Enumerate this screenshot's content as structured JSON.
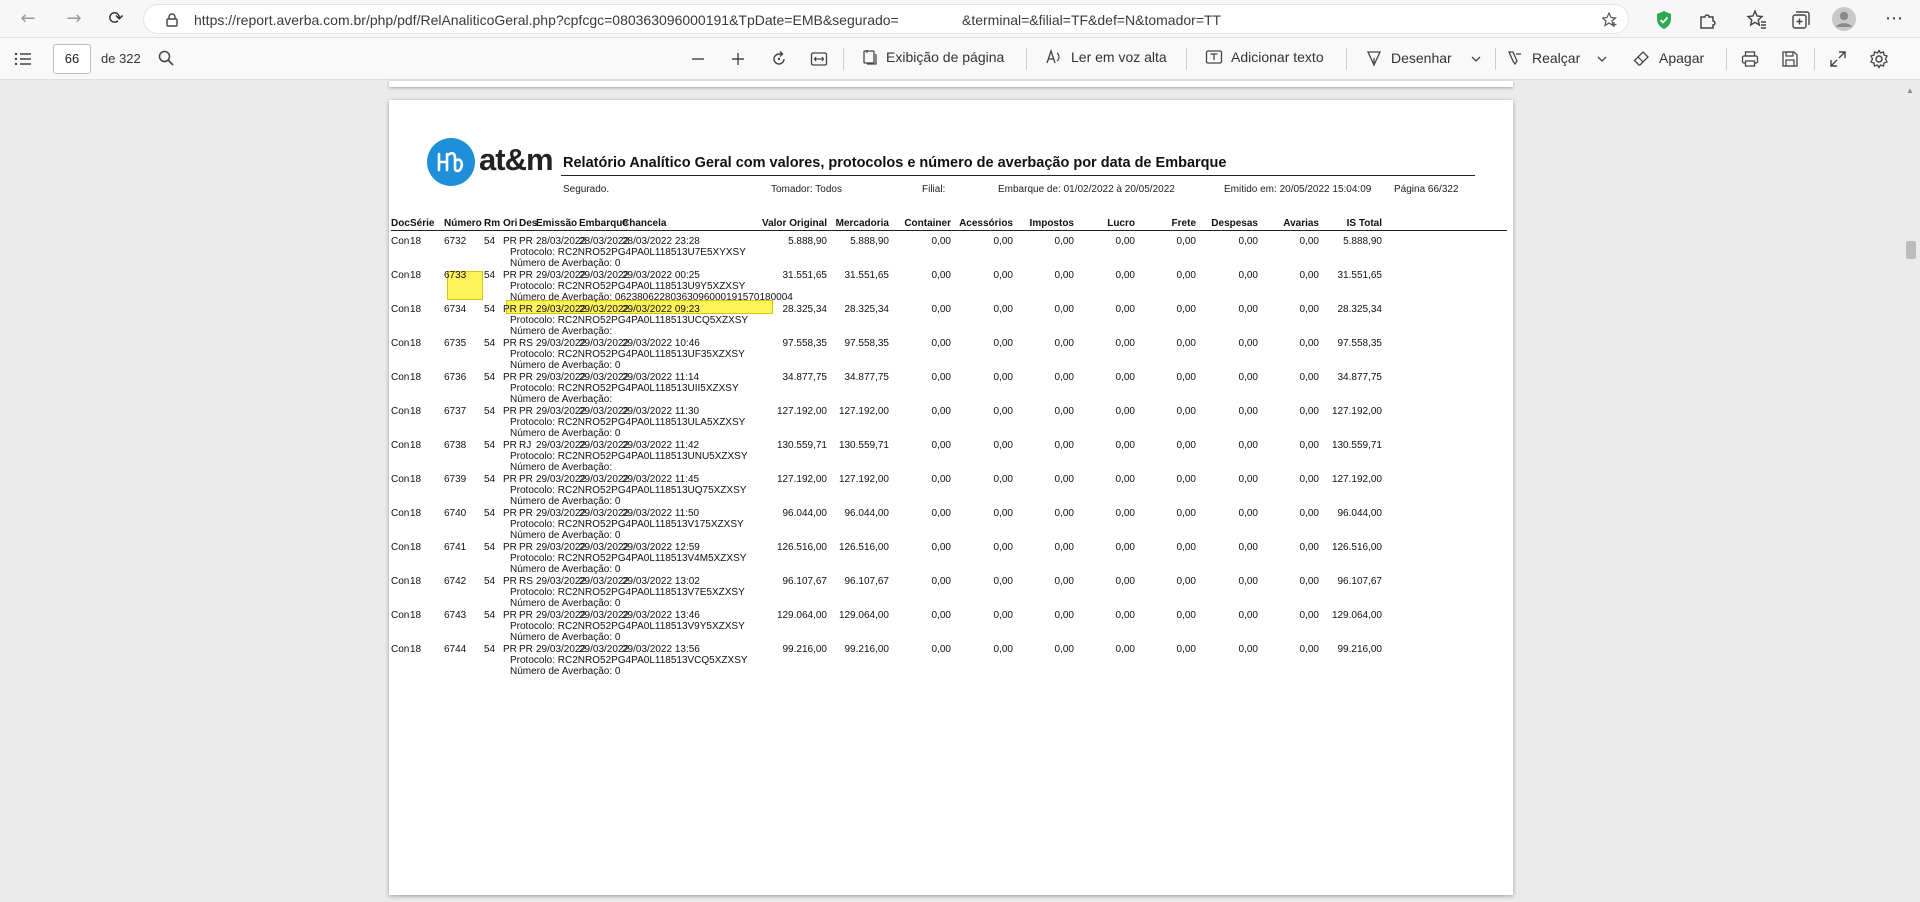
{
  "browser": {
    "url": "https://report.averba.com.br/php/pdf/RelAnaliticoGeral.php?cpfcgc=08036309600019​1&TpDate=EMB&segurado=",
    "url_part1": "https://report.averba.com.br/php/pdf/RelAnaliticoGeral.php?cpfcgc=080363096000191&TpDate=EMB&segurado=",
    "url_part2": "&terminal=&filial=TF&def=N&tomador=TT"
  },
  "pdf_toolbar": {
    "page_current": "66",
    "page_total": "de 322",
    "page_view_label": "Exibição de página",
    "read_aloud_label": "Ler em voz alta",
    "add_text_label": "Adicionar texto",
    "draw_label": "Desenhar",
    "highlight_label": "Realçar",
    "erase_label": "Apagar"
  },
  "report": {
    "logo_text": "at&m",
    "title": "Relatório Analítico Geral com valores, protocolos e número de averbação por data de Embarque",
    "segurado_label": "Segurado.",
    "tomador_label": "Tomador: Todos",
    "filial_label": "Filial:",
    "embarque_label": "Embarque de: 01/02/2022 à 20/05/2022",
    "emitido_label": "Emitido em: 20/05/2022 15:04:09",
    "pagina_label": "Página 66/322",
    "columns": [
      "Doc",
      "Série",
      "Número",
      "Rm",
      "Ori",
      "Des",
      "Emissão",
      "Embarque",
      "Chancela",
      "Valor Original",
      "Mercadoria",
      "Container",
      "Acessórios",
      "Impostos",
      "Lucro",
      "Frete",
      "Despesas",
      "Avarias",
      "IS Total"
    ],
    "protocol_label": "Protocolo:",
    "averbacao_label": "Número de Averbação:",
    "highlighted_averbacao": "Número de Averbação: 06238062280363096000191570180004",
    "rows": [
      {
        "doc": "Con",
        "serie": "18",
        "numero": "6732",
        "rm": "54",
        "ori": "PR",
        "des": "PR",
        "emissao": "28/03/2022",
        "embarque": "28/03/2022",
        "chancela": "28/03/2022 23:28",
        "valor": "5.888,90",
        "mercadoria": "5.888,90",
        "container": "0,00",
        "acessorios": "0,00",
        "impostos": "0,00",
        "lucro": "0,00",
        "frete": "0,00",
        "despesas": "0,00",
        "avarias": "0,00",
        "is_total": "5.888,90",
        "protocolo": "Protocolo: RC2NRO52PG4PA0L118513U7E5XYXSY",
        "averbacao": "Número de Averbação: 0"
      },
      {
        "doc": "Con",
        "serie": "18",
        "numero": "6733",
        "rm": "54",
        "ori": "PR",
        "des": "PR",
        "emissao": "29/03/2022",
        "embarque": "29/03/2022",
        "chancela": "29/03/2022 00:25",
        "valor": "31.551,65",
        "mercadoria": "31.551,65",
        "container": "0,00",
        "acessorios": "0,00",
        "impostos": "0,00",
        "lucro": "0,00",
        "frete": "0,00",
        "despesas": "0,00",
        "avarias": "0,00",
        "is_total": "31.551,65",
        "protocolo": "Protocolo: RC2NRO52PG4PA0L118513U9Y5XZXSY",
        "averbacao": "Número de Averbação: 06238062280363096000191570180004"
      },
      {
        "doc": "Con",
        "serie": "18",
        "numero": "6734",
        "rm": "54",
        "ori": "PR",
        "des": "PR",
        "emissao": "29/03/2022",
        "embarque": "29/03/2022",
        "chancela": "29/03/2022 09:23",
        "valor": "28.325,34",
        "mercadoria": "28.325,34",
        "container": "0,00",
        "acessorios": "0,00",
        "impostos": "0,00",
        "lucro": "0,00",
        "frete": "0,00",
        "despesas": "0,00",
        "avarias": "0,00",
        "is_total": "28.325,34",
        "protocolo": "Protocolo: RC2NRO52PG4PA0L118513UCQ5XZXSY",
        "averbacao": "Número de Averbação:"
      },
      {
        "doc": "Con",
        "serie": "18",
        "numero": "6735",
        "rm": "54",
        "ori": "PR",
        "des": "RS",
        "emissao": "29/03/2022",
        "embarque": "29/03/2022",
        "chancela": "29/03/2022 10:46",
        "valor": "97.558,35",
        "mercadoria": "97.558,35",
        "container": "0,00",
        "acessorios": "0,00",
        "impostos": "0,00",
        "lucro": "0,00",
        "frete": "0,00",
        "despesas": "0,00",
        "avarias": "0,00",
        "is_total": "97.558,35",
        "protocolo": "Protocolo: RC2NRO52PG4PA0L118513UF35XZXSY",
        "averbacao": "Número de Averbação: 0"
      },
      {
        "doc": "Con",
        "serie": "18",
        "numero": "6736",
        "rm": "54",
        "ori": "PR",
        "des": "PR",
        "emissao": "29/03/2022",
        "embarque": "29/03/2022",
        "chancela": "29/03/2022 11:14",
        "valor": "34.877,75",
        "mercadoria": "34.877,75",
        "container": "0,00",
        "acessorios": "0,00",
        "impostos": "0,00",
        "lucro": "0,00",
        "frete": "0,00",
        "despesas": "0,00",
        "avarias": "0,00",
        "is_total": "34.877,75",
        "protocolo": "Protocolo: RC2NRO52PG4PA0L118513UII5XZXSY",
        "averbacao": "Número de Averbação:"
      },
      {
        "doc": "Con",
        "serie": "18",
        "numero": "6737",
        "rm": "54",
        "ori": "PR",
        "des": "PR",
        "emissao": "29/03/2022",
        "embarque": "29/03/2022",
        "chancela": "29/03/2022 11:30",
        "valor": "127.192,00",
        "mercadoria": "127.192,00",
        "container": "0,00",
        "acessorios": "0,00",
        "impostos": "0,00",
        "lucro": "0,00",
        "frete": "0,00",
        "despesas": "0,00",
        "avarias": "0,00",
        "is_total": "127.192,00",
        "protocolo": "Protocolo: RC2NRO52PG4PA0L118513ULA5XZXSY",
        "averbacao": "Número de Averbação: 0"
      },
      {
        "doc": "Con",
        "serie": "18",
        "numero": "6738",
        "rm": "54",
        "ori": "PR",
        "des": "RJ",
        "emissao": "29/03/2022",
        "embarque": "29/03/2022",
        "chancela": "29/03/2022 11:42",
        "valor": "130.559,71",
        "mercadoria": "130.559,71",
        "container": "0,00",
        "acessorios": "0,00",
        "impostos": "0,00",
        "lucro": "0,00",
        "frete": "0,00",
        "despesas": "0,00",
        "avarias": "0,00",
        "is_total": "130.559,71",
        "protocolo": "Protocolo: RC2NRO52PG4PA0L118513UNU5XZXSY",
        "averbacao": "Número de Averbação:"
      },
      {
        "doc": "Con",
        "serie": "18",
        "numero": "6739",
        "rm": "54",
        "ori": "PR",
        "des": "PR",
        "emissao": "29/03/2022",
        "embarque": "29/03/2022",
        "chancela": "29/03/2022 11:45",
        "valor": "127.192,00",
        "mercadoria": "127.192,00",
        "container": "0,00",
        "acessorios": "0,00",
        "impostos": "0,00",
        "lucro": "0,00",
        "frete": "0,00",
        "despesas": "0,00",
        "avarias": "0,00",
        "is_total": "127.192,00",
        "protocolo": "Protocolo: RC2NRO52PG4PA0L118513UQ75XZXSY",
        "averbacao": "Número de Averbação: 0"
      },
      {
        "doc": "Con",
        "serie": "18",
        "numero": "6740",
        "rm": "54",
        "ori": "PR",
        "des": "PR",
        "emissao": "29/03/2022",
        "embarque": "29/03/2022",
        "chancela": "29/03/2022 11:50",
        "valor": "96.044,00",
        "mercadoria": "96.044,00",
        "container": "0,00",
        "acessorios": "0,00",
        "impostos": "0,00",
        "lucro": "0,00",
        "frete": "0,00",
        "despesas": "0,00",
        "avarias": "0,00",
        "is_total": "96.044,00",
        "protocolo": "Protocolo: RC2NRO52PG4PA0L118513V175XZXSY",
        "averbacao": "Número de Averbação: 0"
      },
      {
        "doc": "Con",
        "serie": "18",
        "numero": "6741",
        "rm": "54",
        "ori": "PR",
        "des": "PR",
        "emissao": "29/03/2022",
        "embarque": "29/03/2022",
        "chancela": "29/03/2022 12:59",
        "valor": "126.516,00",
        "mercadoria": "126.516,00",
        "container": "0,00",
        "acessorios": "0,00",
        "impostos": "0,00",
        "lucro": "0,00",
        "frete": "0,00",
        "despesas": "0,00",
        "avarias": "0,00",
        "is_total": "126.516,00",
        "protocolo": "Protocolo: RC2NRO52PG4PA0L118513V4M5XZXSY",
        "averbacao": "Número de Averbação: 0"
      },
      {
        "doc": "Con",
        "serie": "18",
        "numero": "6742",
        "rm": "54",
        "ori": "PR",
        "des": "RS",
        "emissao": "29/03/2022",
        "embarque": "29/03/2022",
        "chancela": "29/03/2022 13:02",
        "valor": "96.107,67",
        "mercadoria": "96.107,67",
        "container": "0,00",
        "acessorios": "0,00",
        "impostos": "0,00",
        "lucro": "0,00",
        "frete": "0,00",
        "despesas": "0,00",
        "avarias": "0,00",
        "is_total": "96.107,67",
        "protocolo": "Protocolo: RC2NRO52PG4PA0L118513V7E5XZXSY",
        "averbacao": "Número de Averbação: 0"
      },
      {
        "doc": "Con",
        "serie": "18",
        "numero": "6743",
        "rm": "54",
        "ori": "PR",
        "des": "PR",
        "emissao": "29/03/2022",
        "embarque": "29/03/2022",
        "chancela": "29/03/2022 13:46",
        "valor": "129.064,00",
        "mercadoria": "129.064,00",
        "container": "0,00",
        "acessorios": "0,00",
        "impostos": "0,00",
        "lucro": "0,00",
        "frete": "0,00",
        "despesas": "0,00",
        "avarias": "0,00",
        "is_total": "129.064,00",
        "protocolo": "Protocolo: RC2NRO52PG4PA0L118513V9Y5XZXSY",
        "averbacao": "Número de Averbação: 0"
      },
      {
        "doc": "Con",
        "serie": "18",
        "numero": "6744",
        "rm": "54",
        "ori": "PR",
        "des": "PR",
        "emissao": "29/03/2022",
        "embarque": "29/03/2022",
        "chancela": "29/03/2022 13:56",
        "valor": "99.216,00",
        "mercadoria": "99.216,00",
        "container": "0,00",
        "acessorios": "0,00",
        "impostos": "0,00",
        "lucro": "0,00",
        "frete": "0,00",
        "despesas": "0,00",
        "avarias": "0,00",
        "is_total": "99.216,00",
        "protocolo": "Protocolo: RC2NRO52PG4PA0L118513VCQ5XZXSY",
        "averbacao": "Número de Averbação: 0"
      }
    ]
  },
  "colors": {
    "highlight": "#fff35c",
    "logo_blue": "#1e8fd8"
  }
}
